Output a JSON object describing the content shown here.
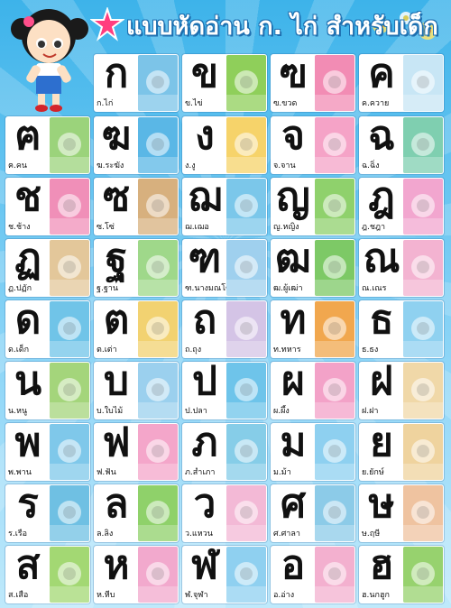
{
  "title": "แบบหัดอ่าน ก. ไก่ สำหรับเด็ก",
  "colors": {
    "background": "#3db3ea",
    "title_outline": "#1d6fb0",
    "card": "#ffffff"
  },
  "cards": [
    {
      "letter": "ก",
      "word": "ก.ไก่",
      "icon": "chicken-icon",
      "color": "#7cc4e8"
    },
    {
      "letter": "ข",
      "word": "ข.ไข่",
      "icon": "eggs-icon",
      "color": "#8fcf5a"
    },
    {
      "letter": "ฃ",
      "word": "ฃ.ขวด",
      "icon": "bottles-icon",
      "color": "#f28cb4"
    },
    {
      "letter": "ค",
      "word": "ค.ควาย",
      "icon": "buffalo-icon",
      "color": "#c8e6f5"
    },
    {
      "letter": "ฅ",
      "word": "ฅ.คน",
      "icon": "person-icon",
      "color": "#9bd37b"
    },
    {
      "letter": "ฆ",
      "word": "ฆ.ระฆัง",
      "icon": "bell-icon",
      "color": "#5ab7e6"
    },
    {
      "letter": "ง",
      "word": "ง.งู",
      "icon": "snake-icon",
      "color": "#f6d36a"
    },
    {
      "letter": "จ",
      "word": "จ.จาน",
      "icon": "plates-icon",
      "color": "#f5a3c7"
    },
    {
      "letter": "ฉ",
      "word": "ฉ.ฉิ่ง",
      "icon": "cymbals-icon",
      "color": "#7fcfb0"
    },
    {
      "letter": "ช",
      "word": "ช.ช้าง",
      "icon": "elephant-icon",
      "color": "#f08fb8"
    },
    {
      "letter": "ซ",
      "word": "ซ.โซ่",
      "icon": "chain-icon",
      "color": "#d7b07e"
    },
    {
      "letter": "ฌ",
      "word": "ฌ.เฌอ",
      "icon": "tree-icon",
      "color": "#7bc7ea"
    },
    {
      "letter": "ญ",
      "word": "ญ.หญิง",
      "icon": "woman-icon",
      "color": "#8fd16c"
    },
    {
      "letter": "ฎ",
      "word": "ฎ.ชฎา",
      "icon": "crown-icon",
      "color": "#f2a6cf"
    },
    {
      "letter": "ฏ",
      "word": "ฏ.ปฏัก",
      "icon": "spear-icon",
      "color": "#e3c79a"
    },
    {
      "letter": "ฐ",
      "word": "ฐ.ฐาน",
      "icon": "pedestal-icon",
      "color": "#9fd88a"
    },
    {
      "letter": "ฑ",
      "word": "ฑ.นางมณโฑ",
      "icon": "lady-icon",
      "color": "#9fd0ee"
    },
    {
      "letter": "ฒ",
      "word": "ฒ.ผู้เฒ่า",
      "icon": "elder-icon",
      "color": "#7dc966"
    },
    {
      "letter": "ณ",
      "word": "ณ.เณร",
      "icon": "novice-icon",
      "color": "#f3b3d1"
    },
    {
      "letter": "ด",
      "word": "ด.เด็ก",
      "icon": "child-icon",
      "color": "#70c4e8"
    },
    {
      "letter": "ต",
      "word": "ต.เต่า",
      "icon": "turtle-icon",
      "color": "#f2d271"
    },
    {
      "letter": "ถ",
      "word": "ถ.ถุง",
      "icon": "bag-icon",
      "color": "#d4c4e6"
    },
    {
      "letter": "ท",
      "word": "ท.ทหาร",
      "icon": "soldier-icon",
      "color": "#f1a74e"
    },
    {
      "letter": "ธ",
      "word": "ธ.ธง",
      "icon": "flag-icon",
      "color": "#8fd1f0"
    },
    {
      "letter": "น",
      "word": "น.หนู",
      "icon": "mouse-icon",
      "color": "#a4d57b"
    },
    {
      "letter": "บ",
      "word": "บ.ใบไม้",
      "icon": "leaf-icon",
      "color": "#9bd0ee"
    },
    {
      "letter": "ป",
      "word": "ป.ปลา",
      "icon": "fish-icon",
      "color": "#6ec4ea"
    },
    {
      "letter": "ผ",
      "word": "ผ.ผึ้ง",
      "icon": "bee-icon",
      "color": "#f3a2c8"
    },
    {
      "letter": "ฝ",
      "word": "ฝ.ฝา",
      "icon": "lid-icon",
      "color": "#f0d8a8"
    },
    {
      "letter": "พ",
      "word": "พ.พาน",
      "icon": "tray-icon",
      "color": "#7fc8ea"
    },
    {
      "letter": "ฟ",
      "word": "ฟ.ฟัน",
      "icon": "tooth-icon",
      "color": "#f4a6ca"
    },
    {
      "letter": "ภ",
      "word": "ภ.สำเภา",
      "icon": "junk-ship-icon",
      "color": "#86cde8"
    },
    {
      "letter": "ม",
      "word": "ม.ม้า",
      "icon": "horse-icon",
      "color": "#8ed0f0"
    },
    {
      "letter": "ย",
      "word": "ย.ยักษ์",
      "icon": "giant-icon",
      "color": "#efd39e"
    },
    {
      "letter": "ร",
      "word": "ร.เรือ",
      "icon": "boat-icon",
      "color": "#6fc0e3"
    },
    {
      "letter": "ล",
      "word": "ล.ลิง",
      "icon": "monkey-icon",
      "color": "#8fd16a"
    },
    {
      "letter": "ว",
      "word": "ว.แหวน",
      "icon": "ring-icon",
      "color": "#f3b9d6"
    },
    {
      "letter": "ศ",
      "word": "ศ.ศาลา",
      "icon": "pavilion-icon",
      "color": "#8ccbe8"
    },
    {
      "letter": "ษ",
      "word": "ษ.ฤษี",
      "icon": "hermit-icon",
      "color": "#efc3a0"
    },
    {
      "letter": "ส",
      "word": "ส.เสือ",
      "icon": "tiger-icon",
      "color": "#a3d873"
    },
    {
      "letter": "ห",
      "word": "ห.หีบ",
      "icon": "chest-icon",
      "color": "#f2a9cd"
    },
    {
      "letter": "ฬ",
      "word": "ฬ.จุฬา",
      "icon": "star-kite-icon",
      "color": "#8fd0f0"
    },
    {
      "letter": "อ",
      "word": "อ.อ่าง",
      "icon": "basin-icon",
      "color": "#f3b0cf"
    },
    {
      "letter": "ฮ",
      "word": "ฮ.นกฮูก",
      "icon": "owl-icon",
      "color": "#97d26e"
    }
  ]
}
